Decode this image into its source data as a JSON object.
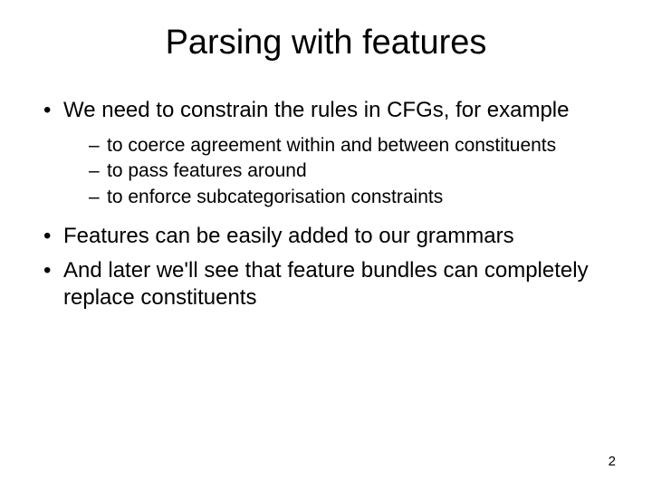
{
  "title": "Parsing with features",
  "bullets": [
    {
      "text": "We need to constrain the rules in CFGs, for example",
      "children": [
        "to coerce agreement within and between constituents",
        "to pass features around",
        "to enforce subcategorisation constraints"
      ]
    },
    {
      "text": "Features can be easily added to our grammars"
    },
    {
      "text": "And later we'll see that feature bundles can completely replace constituents"
    }
  ],
  "page_number": "2"
}
